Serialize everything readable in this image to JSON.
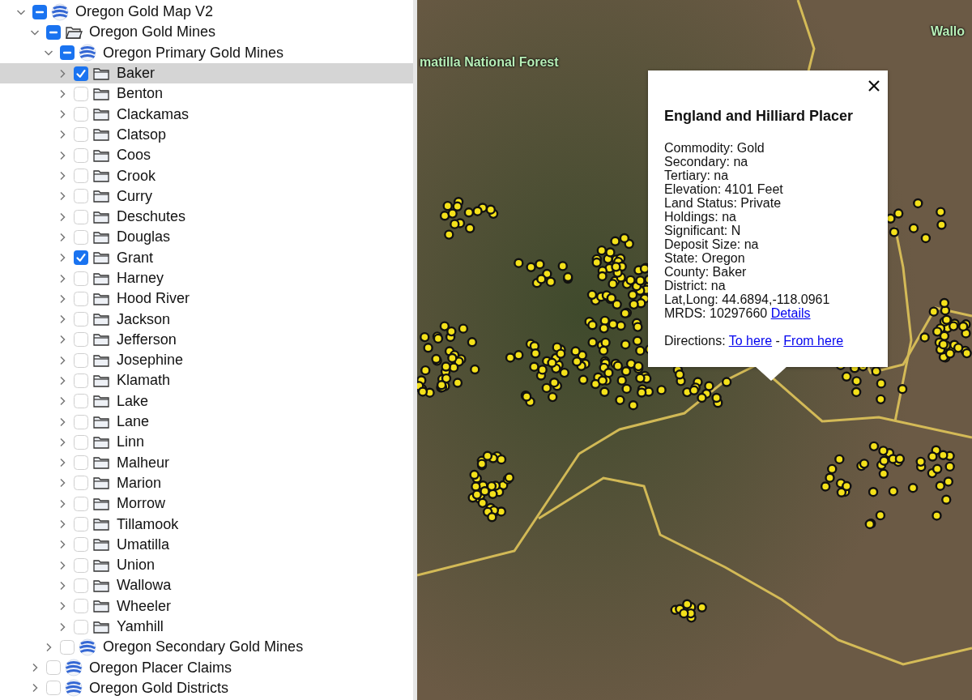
{
  "sidebar": {
    "tree": [
      {
        "label": "Oregon Gold Map V2",
        "kind": "globe",
        "checked": false,
        "mixed": true,
        "expanded": true,
        "selected": false,
        "children": [
          {
            "label": "Oregon Gold Mines",
            "kind": "folder-open",
            "checked": false,
            "mixed": true,
            "expanded": true,
            "selected": false,
            "children": [
              {
                "label": "Oregon Primary Gold Mines",
                "kind": "globe",
                "checked": false,
                "mixed": true,
                "expanded": true,
                "selected": false,
                "children": [
                  {
                    "label": "Baker",
                    "kind": "folder",
                    "checked": true,
                    "mixed": false,
                    "expanded": false,
                    "selected": true
                  },
                  {
                    "label": "Benton",
                    "kind": "folder",
                    "checked": false,
                    "mixed": false,
                    "expanded": false,
                    "selected": false
                  },
                  {
                    "label": "Clackamas",
                    "kind": "folder",
                    "checked": false,
                    "mixed": false,
                    "expanded": false,
                    "selected": false
                  },
                  {
                    "label": "Clatsop",
                    "kind": "folder",
                    "checked": false,
                    "mixed": false,
                    "expanded": false,
                    "selected": false
                  },
                  {
                    "label": "Coos",
                    "kind": "folder",
                    "checked": false,
                    "mixed": false,
                    "expanded": false,
                    "selected": false
                  },
                  {
                    "label": "Crook",
                    "kind": "folder",
                    "checked": false,
                    "mixed": false,
                    "expanded": false,
                    "selected": false
                  },
                  {
                    "label": "Curry",
                    "kind": "folder",
                    "checked": false,
                    "mixed": false,
                    "expanded": false,
                    "selected": false
                  },
                  {
                    "label": "Deschutes",
                    "kind": "folder",
                    "checked": false,
                    "mixed": false,
                    "expanded": false,
                    "selected": false
                  },
                  {
                    "label": "Douglas",
                    "kind": "folder",
                    "checked": false,
                    "mixed": false,
                    "expanded": false,
                    "selected": false
                  },
                  {
                    "label": "Grant",
                    "kind": "folder",
                    "checked": true,
                    "mixed": false,
                    "expanded": false,
                    "selected": false
                  },
                  {
                    "label": "Harney",
                    "kind": "folder",
                    "checked": false,
                    "mixed": false,
                    "expanded": false,
                    "selected": false
                  },
                  {
                    "label": "Hood River",
                    "kind": "folder",
                    "checked": false,
                    "mixed": false,
                    "expanded": false,
                    "selected": false
                  },
                  {
                    "label": "Jackson",
                    "kind": "folder",
                    "checked": false,
                    "mixed": false,
                    "expanded": false,
                    "selected": false
                  },
                  {
                    "label": "Jefferson",
                    "kind": "folder",
                    "checked": false,
                    "mixed": false,
                    "expanded": false,
                    "selected": false
                  },
                  {
                    "label": "Josephine",
                    "kind": "folder",
                    "checked": false,
                    "mixed": false,
                    "expanded": false,
                    "selected": false
                  },
                  {
                    "label": "Klamath",
                    "kind": "folder",
                    "checked": false,
                    "mixed": false,
                    "expanded": false,
                    "selected": false
                  },
                  {
                    "label": "Lake",
                    "kind": "folder",
                    "checked": false,
                    "mixed": false,
                    "expanded": false,
                    "selected": false
                  },
                  {
                    "label": "Lane",
                    "kind": "folder",
                    "checked": false,
                    "mixed": false,
                    "expanded": false,
                    "selected": false
                  },
                  {
                    "label": "Linn",
                    "kind": "folder",
                    "checked": false,
                    "mixed": false,
                    "expanded": false,
                    "selected": false
                  },
                  {
                    "label": "Malheur",
                    "kind": "folder",
                    "checked": false,
                    "mixed": false,
                    "expanded": false,
                    "selected": false
                  },
                  {
                    "label": "Marion",
                    "kind": "folder",
                    "checked": false,
                    "mixed": false,
                    "expanded": false,
                    "selected": false
                  },
                  {
                    "label": "Morrow",
                    "kind": "folder",
                    "checked": false,
                    "mixed": false,
                    "expanded": false,
                    "selected": false
                  },
                  {
                    "label": "Tillamook",
                    "kind": "folder",
                    "checked": false,
                    "mixed": false,
                    "expanded": false,
                    "selected": false
                  },
                  {
                    "label": "Umatilla",
                    "kind": "folder",
                    "checked": false,
                    "mixed": false,
                    "expanded": false,
                    "selected": false
                  },
                  {
                    "label": "Union",
                    "kind": "folder",
                    "checked": false,
                    "mixed": false,
                    "expanded": false,
                    "selected": false
                  },
                  {
                    "label": "Wallowa",
                    "kind": "folder",
                    "checked": false,
                    "mixed": false,
                    "expanded": false,
                    "selected": false
                  },
                  {
                    "label": "Wheeler",
                    "kind": "folder",
                    "checked": false,
                    "mixed": false,
                    "expanded": false,
                    "selected": false
                  },
                  {
                    "label": "Yamhill",
                    "kind": "folder",
                    "checked": false,
                    "mixed": false,
                    "expanded": false,
                    "selected": false
                  }
                ]
              },
              {
                "label": "Oregon Secondary Gold Mines",
                "kind": "globe",
                "checked": false,
                "mixed": false,
                "expanded": false,
                "selected": false
              }
            ]
          },
          {
            "label": "Oregon Placer Claims",
            "kind": "globe",
            "checked": false,
            "mixed": false,
            "expanded": false,
            "selected": false
          },
          {
            "label": "Oregon Gold Districts",
            "kind": "globe",
            "checked": false,
            "mixed": false,
            "expanded": false,
            "selected": false
          }
        ]
      }
    ]
  },
  "map": {
    "labels": [
      "matilla National Forest",
      "Wallo"
    ],
    "popup": {
      "title": "England and Hilliard Placer",
      "fields": [
        "Commodity: Gold",
        "Secondary: na",
        "Tertiary: na",
        "Elevation: 4101 Feet",
        "Land Status: Private",
        "Holdings: na",
        "Significant: N",
        "Deposit Size: na",
        "State: Oregon",
        "County: Baker",
        "District: na",
        "Lat,Long: 44.6894,-118.0961"
      ],
      "mrds": "MRDS: 10297660",
      "details_link": "Details",
      "directions_label": "Directions:",
      "to_here": "To here",
      "separator": "-",
      "from_here": "From here"
    }
  }
}
